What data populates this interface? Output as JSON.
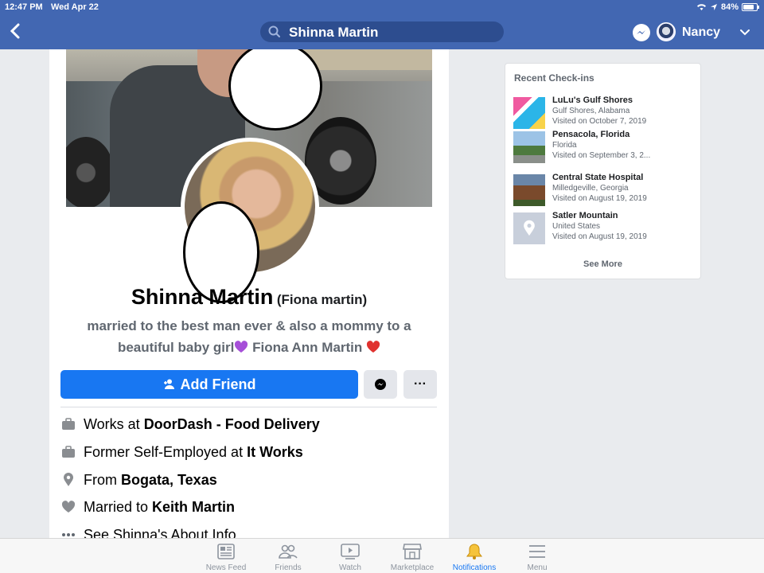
{
  "status_bar": {
    "time": "12:47 PM",
    "date": "Wed Apr 22",
    "battery": "84%"
  },
  "header": {
    "search_text": "Shinna Martin",
    "user_name": "Nancy"
  },
  "profile": {
    "name": "Shinna Martin",
    "alt_name": "(Fiona martin)",
    "bio_line1": "married to the best man ever & also a mommy to a",
    "bio_line2": "beautiful baby girl",
    "bio_name": "Fiona Ann Martin",
    "add_friend_label": "Add Friend",
    "more_label": "···"
  },
  "info": [
    {
      "icon": "briefcase-icon",
      "prefix": "Works at",
      "bold": "DoorDash - Food Delivery"
    },
    {
      "icon": "briefcase-icon",
      "prefix": "Former Self-Employed at",
      "bold": "It Works"
    },
    {
      "icon": "location-pin-icon",
      "prefix": "From",
      "bold": "Bogata, Texas"
    },
    {
      "icon": "heart-icon",
      "prefix": "Married to",
      "bold": "Keith Martin"
    },
    {
      "icon": "more-dots-icon",
      "prefix": "See Shinna's About Info",
      "bold": ""
    }
  ],
  "checkins": {
    "title": "Recent Check-ins",
    "items": [
      {
        "name": "LuLu's Gulf Shores",
        "location": "Gulf Shores, Alabama",
        "visited": "Visited on October 7, 2019"
      },
      {
        "name": "Pensacola, Florida",
        "location": "Florida",
        "visited": "Visited on September 3, 2..."
      },
      {
        "name": "Central State Hospital",
        "location": "Milledgeville, Georgia",
        "visited": "Visited on August 19, 2019"
      },
      {
        "name": "Satler Mountain",
        "location": "United States",
        "visited": "Visited on August 19, 2019"
      }
    ],
    "see_more": "See More"
  },
  "tabs": [
    {
      "label": "News Feed",
      "icon": "news-feed-icon"
    },
    {
      "label": "Friends",
      "icon": "friends-icon"
    },
    {
      "label": "Watch",
      "icon": "watch-icon"
    },
    {
      "label": "Marketplace",
      "icon": "marketplace-icon"
    },
    {
      "label": "Notifications",
      "icon": "bell-icon",
      "active": true
    },
    {
      "label": "Menu",
      "icon": "menu-icon"
    }
  ],
  "colors": {
    "header_blue": "#4267b2",
    "accent": "#1877f2",
    "bell_yellow": "#f5c33b"
  }
}
